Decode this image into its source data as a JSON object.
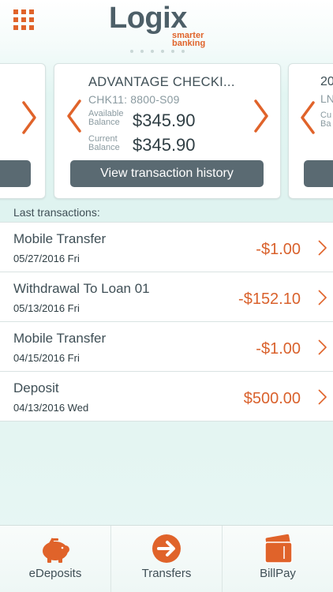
{
  "header": {
    "menu_icon": "grid-menu-icon",
    "logo": {
      "word": "Logix",
      "tagline_1": "smarter",
      "tagline_2": "banking"
    }
  },
  "carousel": {
    "current_card": {
      "title": "ADVANTAGE CHECKI...",
      "account": "CHK11: 8800-S09",
      "available_label_1": "Available",
      "available_label_2": "Balance",
      "available_balance": "$345.90",
      "current_label_1": "Current",
      "current_label_2": "Balance",
      "current_balance": "$345.90",
      "history_button": "View transaction history"
    },
    "next_card": {
      "title": "20",
      "account": "LN",
      "label_1": "Cu",
      "label_2": "Ba"
    }
  },
  "transactions": {
    "header": "Last transactions:",
    "items": [
      {
        "description": "Mobile Transfer",
        "date": "05/27/2016 Fri",
        "amount": "-$1.00"
      },
      {
        "description": "Withdrawal To Loan 01",
        "date": "05/13/2016 Fri",
        "amount": "-$152.10"
      },
      {
        "description": "Mobile Transfer",
        "date": "04/15/2016 Fri",
        "amount": "-$1.00"
      },
      {
        "description": "Deposit",
        "date": "04/13/2016 Wed",
        "amount": "$500.00"
      }
    ]
  },
  "tabbar": {
    "tabs": [
      {
        "label": "eDeposits",
        "icon": "piggy-bank-icon"
      },
      {
        "label": "Transfers",
        "icon": "arrow-circle-icon"
      },
      {
        "label": "BillPay",
        "icon": "wallet-icon"
      }
    ]
  },
  "colors": {
    "accent": "#e0632a",
    "text_dark": "#3f4f56",
    "button": "#5a6a72",
    "amount": "#d9612c"
  }
}
